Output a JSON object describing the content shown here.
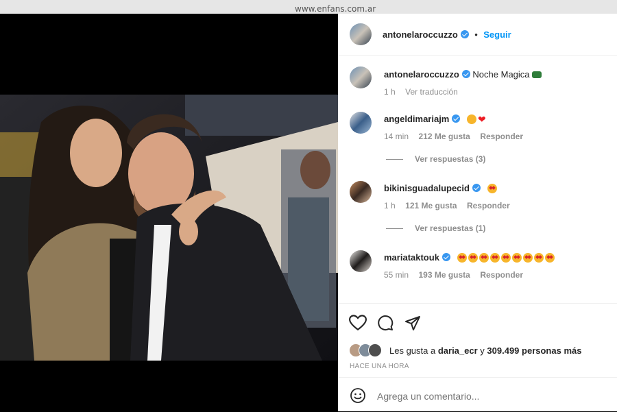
{
  "watermark": "www.enfans.com.ar",
  "post": {
    "author": "antonelaroccuzzo",
    "follow_label": "Seguir",
    "caption": "Noche Magica",
    "caption_time": "1 h",
    "translate_label": "Ver traducción"
  },
  "comments": [
    {
      "user": "angeldimariajm",
      "time": "14 min",
      "likes": "212 Me gusta",
      "reply": "Responder",
      "replies": "Ver respuestas (3)"
    },
    {
      "user": "bikinisguadalupecid",
      "time": "1 h",
      "likes": "121 Me gusta",
      "reply": "Responder",
      "replies": "Ver respuestas (1)"
    },
    {
      "user": "mariataktouk",
      "time": "55 min",
      "likes": "193 Me gusta",
      "reply": "Responder"
    }
  ],
  "likes_line": {
    "prefix": "Les gusta a",
    "user": "daria_ecr",
    "middle": "y",
    "count": "309.499 personas más"
  },
  "timestamp": "HACE UNA HORA",
  "comment_input": {
    "placeholder": "Agrega un comentario..."
  },
  "icons": [
    "heart-icon",
    "comment-icon",
    "share-icon",
    "emoji-icon",
    "verified-badge-icon"
  ],
  "colors": {
    "accent": "#0095f6",
    "muted": "#8e8e8e",
    "verified": "#3897f0"
  }
}
